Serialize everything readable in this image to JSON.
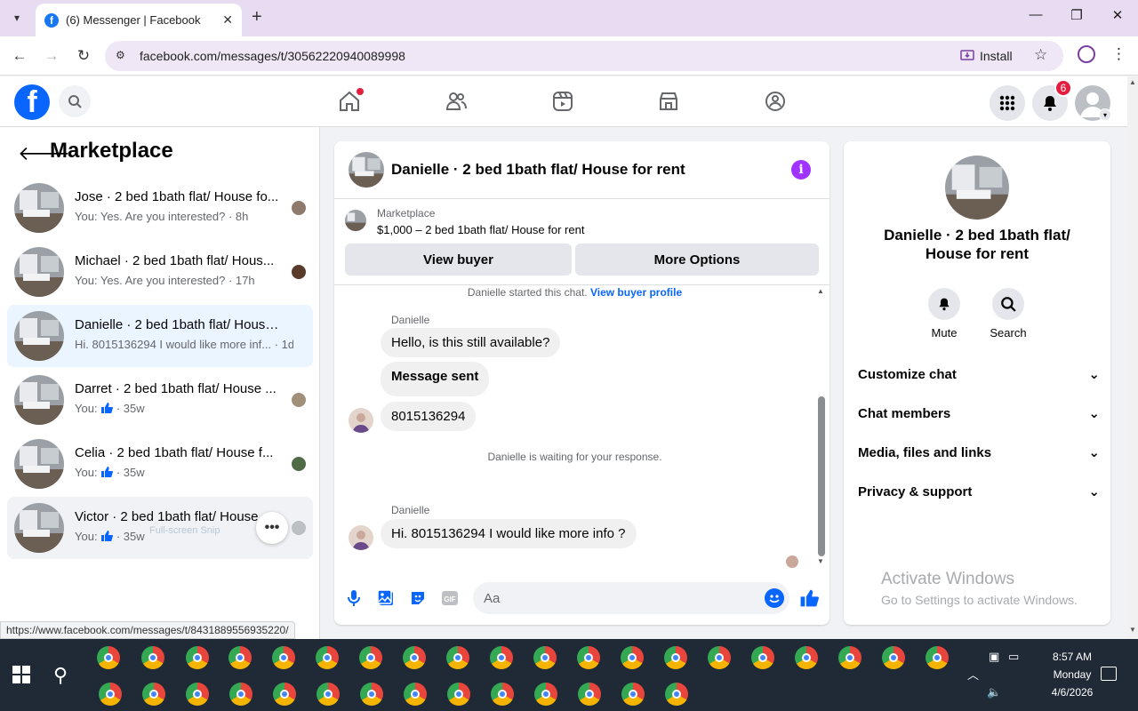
{
  "browser": {
    "tab_title": "(6) Messenger | Facebook",
    "url": "facebook.com/messages/t/30562220940089998",
    "install_label": "Install",
    "status_url": "https://www.facebook.com/messages/t/8431889556935220/"
  },
  "fb": {
    "notifications_count": "6"
  },
  "left": {
    "title": "Marketplace",
    "conversations": [
      {
        "name": "Jose · 2 bed 1bath flat/ House fo...",
        "preview": "You: Yes. Are you interested? · 8h",
        "state": "normal"
      },
      {
        "name": "Michael · 2 bed 1bath flat/ Hous...",
        "preview": "You: Yes. Are you interested? · 17h",
        "state": "normal"
      },
      {
        "name": "Danielle · 2 bed 1bath flat/ House f...",
        "preview": "Hi. 8015136294 I would like more inf... · 1d",
        "state": "active"
      },
      {
        "name": "Darret · 2 bed 1bath flat/ House ...",
        "preview_prefix": "You:",
        "preview_suffix": "· 35w",
        "state": "normal"
      },
      {
        "name": "Celia · 2 bed 1bath flat/ House f...",
        "preview_prefix": "You:",
        "preview_suffix": "· 35w",
        "state": "normal"
      },
      {
        "name": "Victor · 2 bed 1bath flat/ House ...",
        "preview_prefix": "You:",
        "preview_suffix": "· 35w",
        "state": "hover"
      }
    ],
    "snip_overlay": "Full-screen Snip"
  },
  "chat": {
    "title": "Danielle · 2 bed 1bath flat/ House for rent",
    "listing_source": "Marketplace",
    "listing_desc": "$1,000 – 2 bed 1bath flat/ House for rent",
    "view_buyer": "View buyer",
    "more_options": "More Options",
    "started_text": "Danielle started this chat.",
    "started_link": "View buyer profile",
    "sender1": "Danielle",
    "msg1": "Hello, is this still available?",
    "msg2": "Message sent",
    "msg3": "8015136294",
    "waiting": "Danielle is waiting for your response.",
    "sender2": "Danielle",
    "msg4": "Hi. 8015136294 I would like more info ?",
    "composer_placeholder": "Aa"
  },
  "right": {
    "name": "Danielle · 2 bed 1bath flat/ House for rent",
    "mute": "Mute",
    "search": "Search",
    "sections": [
      "Customize chat",
      "Chat members",
      "Media, files and links",
      "Privacy & support"
    ],
    "activate_title": "Activate Windows",
    "activate_sub": "Go to Settings to activate Windows."
  },
  "taskbar": {
    "time": "8:57 AM",
    "day": "Monday",
    "date": "4/6/2026"
  }
}
